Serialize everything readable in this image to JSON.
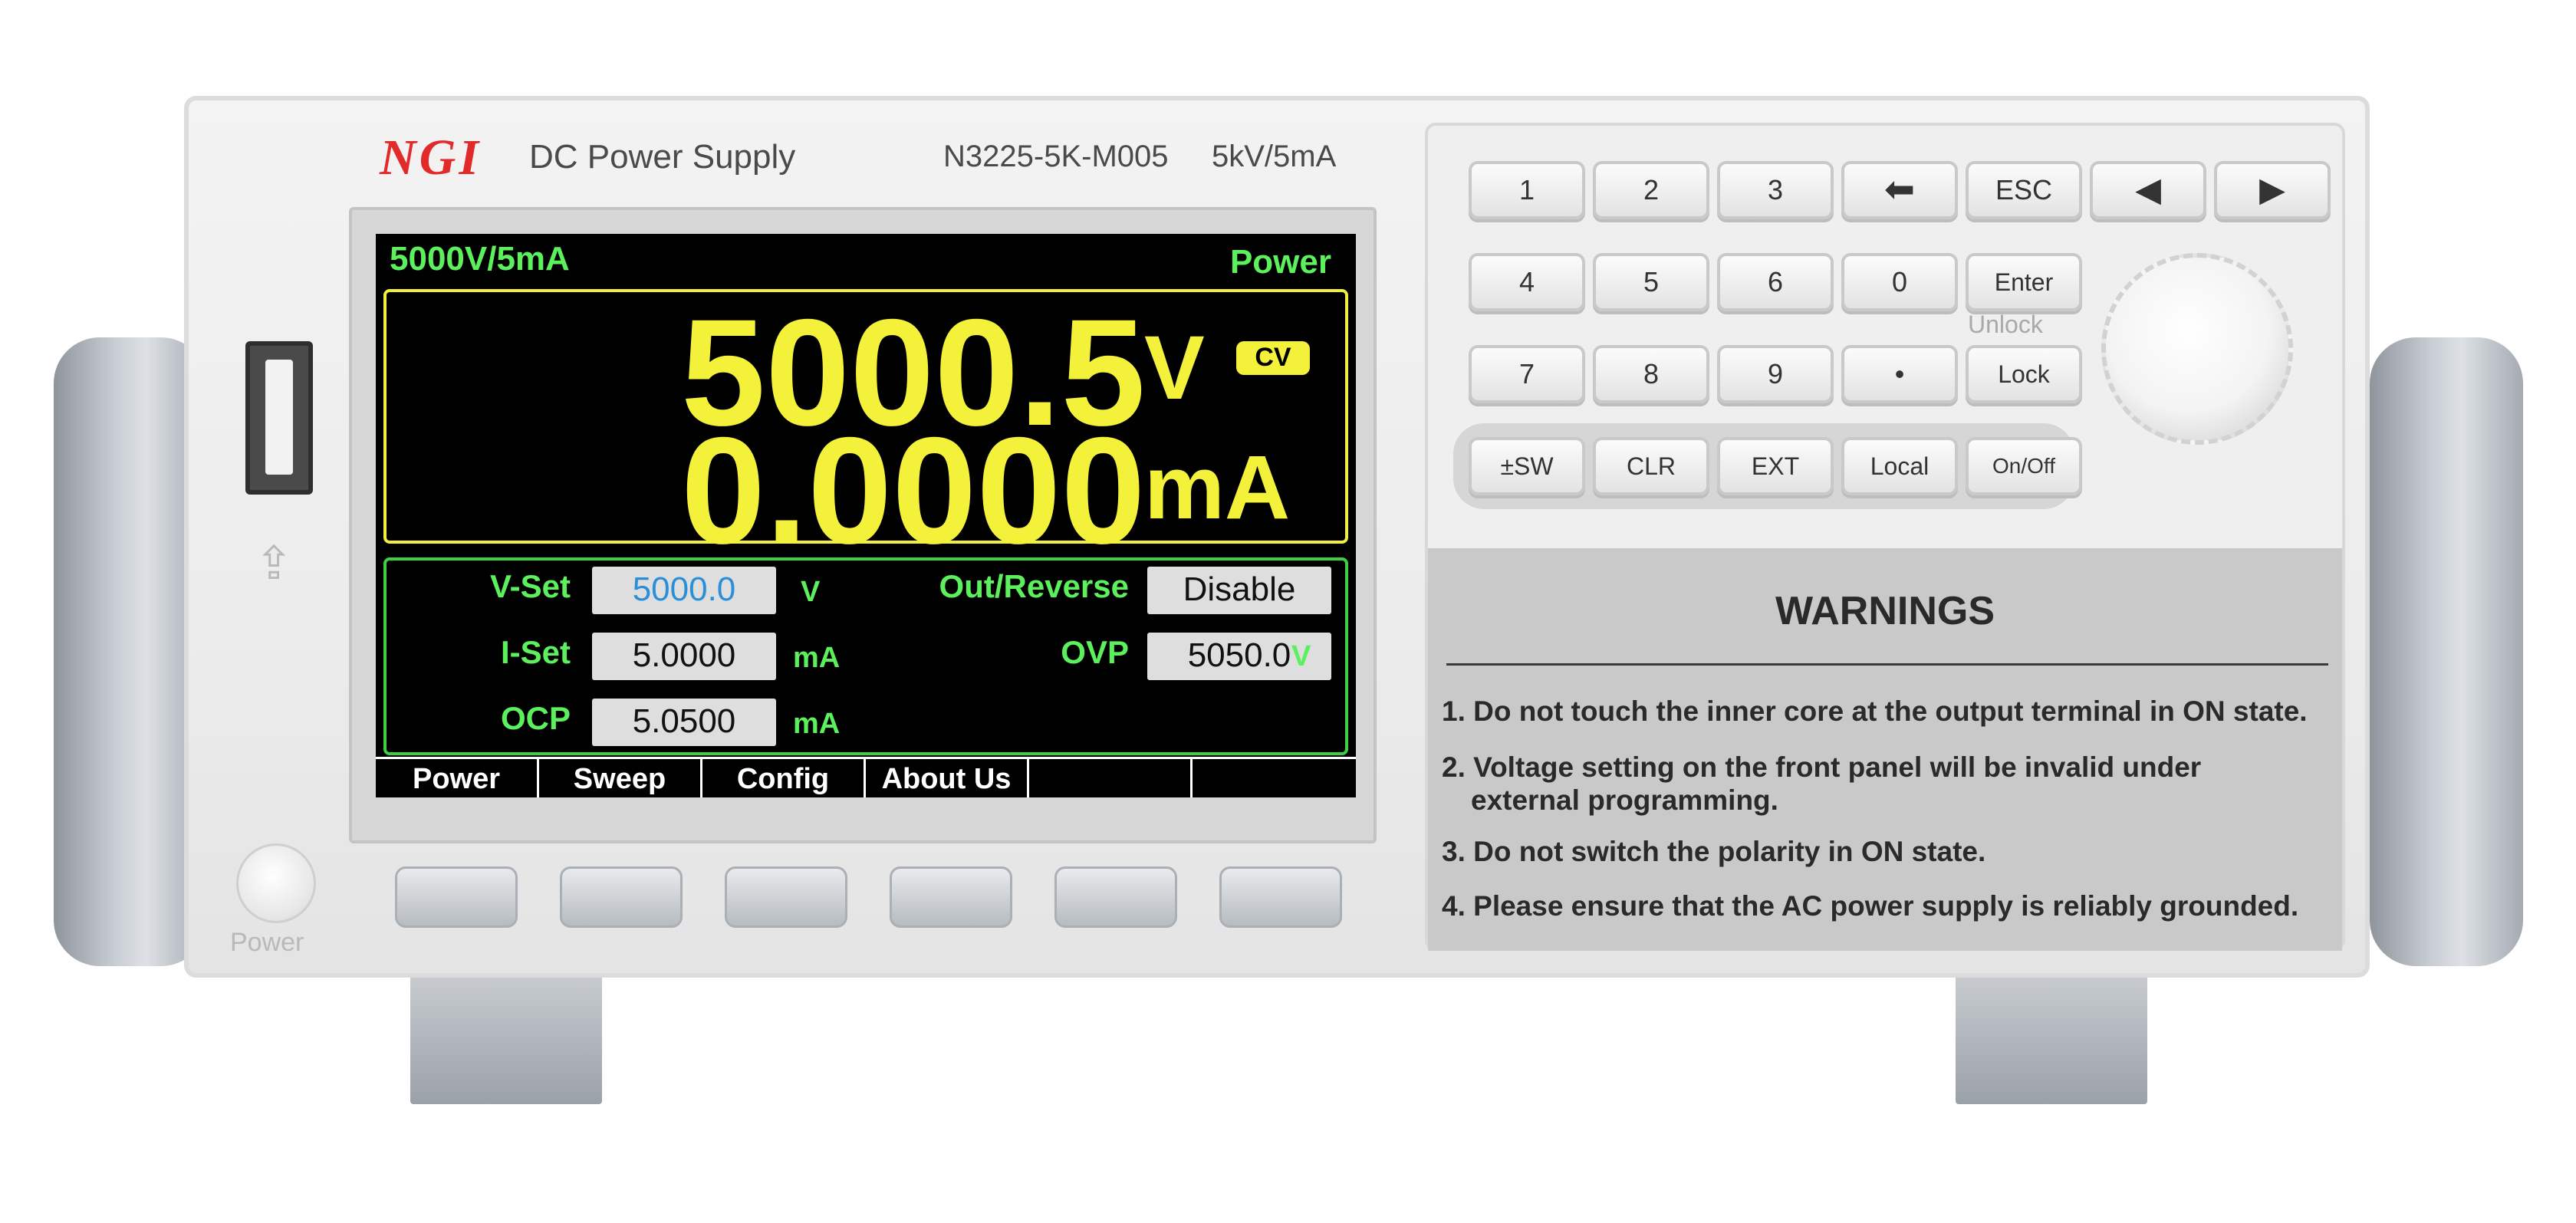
{
  "header": {
    "brand": "NGI",
    "product": "DC Power Supply",
    "model": "N3225-5K-M005",
    "rating": "5kV/5mA"
  },
  "screen": {
    "range": "5000V/5mA",
    "mode": "Power",
    "voltage": "5000.5",
    "voltage_unit": "V",
    "current": "0.0000",
    "current_unit": "mA",
    "status": "CV",
    "settings": {
      "vset_label": "V-Set",
      "vset_value": "5000.0",
      "vset_unit": "V",
      "iset_label": "I-Set",
      "iset_value": "5.0000",
      "iset_unit": "mA",
      "ocp_label": "OCP",
      "ocp_value": "5.0500",
      "ocp_unit": "mA",
      "reverse_label": "Out/Reverse",
      "reverse_value": "Disable",
      "ovp_label": "OVP",
      "ovp_value": "5050.0",
      "ovp_unit": "V"
    },
    "menu": [
      "Power",
      "Sweep",
      "Config",
      "About Us",
      "",
      ""
    ]
  },
  "keypad": {
    "row1": [
      "1",
      "2",
      "3",
      "⬅",
      "ESC",
      "◀",
      "▶"
    ],
    "row2": [
      "4",
      "5",
      "6",
      "0",
      "Enter"
    ],
    "row3": [
      "7",
      "8",
      "9",
      "•",
      "Lock"
    ],
    "row4": [
      "±SW",
      "CLR",
      "EXT",
      "Local",
      "On/Off"
    ],
    "unlock_label": "Unlock"
  },
  "power_label": "Power",
  "warnings": {
    "title": "WARNINGS",
    "items": [
      "1. Do not touch the inner core at the output terminal in ON state.",
      "2. Voltage setting on the front panel will be invalid under",
      "external programming.",
      "3. Do not switch the polarity in ON state.",
      "4. Please ensure that the AC power supply is reliably grounded."
    ]
  },
  "colors": {
    "display_yellow": "#f4f13a",
    "display_green": "#5cf05c",
    "active_value_blue": "#2a8fd8",
    "brand_red": "#e32a2a"
  }
}
